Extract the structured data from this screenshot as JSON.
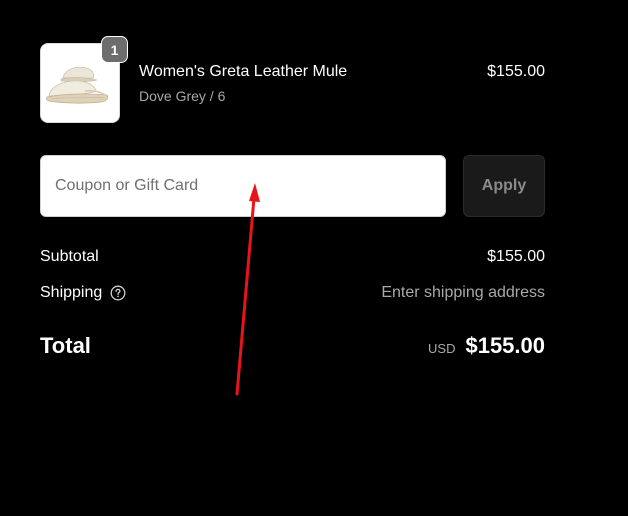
{
  "cart_item": {
    "quantity": "1",
    "name": "Women's Greta Leather Mule",
    "variant": "Dove Grey / 6",
    "price": "$155.00"
  },
  "discount": {
    "placeholder": "Coupon or Gift Card",
    "value": "",
    "apply_label": "Apply"
  },
  "summary": {
    "subtotal_label": "Subtotal",
    "subtotal_value": "$155.00",
    "shipping_label": "Shipping",
    "shipping_help_icon": "question-circle-icon",
    "shipping_value": "Enter shipping address",
    "total_label": "Total",
    "currency": "USD",
    "total_value": "$155.00"
  },
  "colors": {
    "background": "#000000",
    "annotation_arrow": "#e8141c",
    "muted_text": "#a8a8a8"
  }
}
